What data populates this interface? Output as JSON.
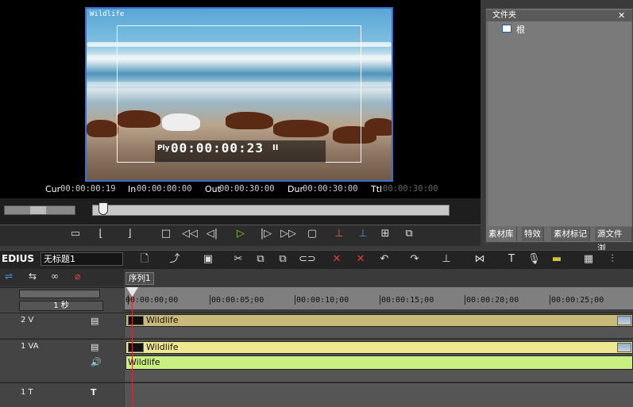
{
  "player": {
    "clip_name": "Wildlife",
    "overlay_mode": "Ply",
    "overlay_timecode": "00:00:00:23",
    "overlay_state": "II",
    "timecodes": [
      {
        "label": "Cur",
        "value": "00:00:00:19",
        "dim": false
      },
      {
        "label": "In",
        "value": "00:00:00:00",
        "dim": false
      },
      {
        "label": "Out",
        "value": "00:00:30:00",
        "dim": false
      },
      {
        "label": "Dur",
        "value": "00:00:30:00",
        "dim": false
      },
      {
        "label": "Ttl",
        "value": "00:00:30:00",
        "dim": true
      }
    ]
  },
  "transport": {
    "buttons": [
      "mark-clip",
      "set-in",
      "set-out",
      "stop",
      "rewind",
      "step-back",
      "play",
      "step-forward",
      "fast-forward",
      "loop",
      "insert",
      "overwrite",
      "add-to-timeline",
      "export"
    ],
    "play_color": "#7dd33a"
  },
  "bin": {
    "title": "文件夹",
    "close": "✕",
    "tree_root": "根",
    "tabs": [
      "素材库",
      "特效",
      "素材标记",
      "源文件浏"
    ]
  },
  "menubar": {
    "app_name": "EDIUS",
    "project_name": "无标题1"
  },
  "timeline": {
    "sequence_tab": "序列1",
    "scale_label": "1 秒",
    "ruler_labels": [
      "00:00:00;00",
      "00:00:05;00",
      "00:00:10;00",
      "00:00:15;00",
      "00:00:20;00",
      "00:00:25;00"
    ],
    "tracks": [
      {
        "name": "2 V",
        "clip": "Wildlife",
        "clip_color": "#c9b97a"
      },
      {
        "name": "1 VA",
        "clip": "Wildlife",
        "clip_color": "#f0e890",
        "audio_clip": "Wildlife"
      },
      {
        "name": "1 T"
      }
    ],
    "playhead_time": "00:00:00:19"
  }
}
